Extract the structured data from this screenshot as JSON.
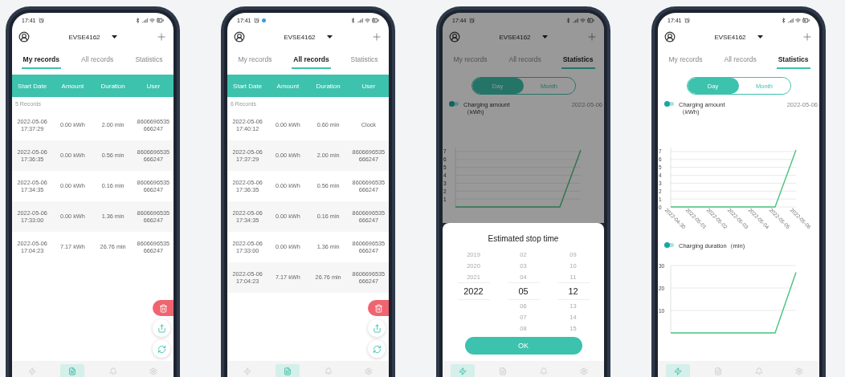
{
  "phones": [
    {
      "kind": "records",
      "status": {
        "time": "17:41"
      },
      "header": {
        "device": "EVSE4162"
      },
      "tabs": [
        {
          "label": "My records",
          "selected": true
        },
        {
          "label": "All records",
          "selected": false
        },
        {
          "label": "Statistics",
          "selected": false
        }
      ],
      "table": {
        "columns": [
          "Start Date",
          "Amount",
          "Duration",
          "User"
        ],
        "count": "5 Records",
        "rows": [
          {
            "date": "2022-05-06 17:37:29",
            "amount": "0.00 kWh",
            "duration": "2.00 min",
            "user": "8606696535 666247"
          },
          {
            "date": "2022-05-06 17:36:35",
            "amount": "0.00 kWh",
            "duration": "0.56 min",
            "user": "8606696535 666247"
          },
          {
            "date": "2022-05-06 17:34:35",
            "amount": "0.00 kWh",
            "duration": "0.16 min",
            "user": "8606696535 666247"
          },
          {
            "date": "2022-05-06 17:33:00",
            "amount": "0.00 kWh",
            "duration": "1.36 min",
            "user": "8606696535 666247"
          },
          {
            "date": "2022-05-06 17:04:23",
            "amount": "7.17 kWh",
            "duration": "26.76 min",
            "user": "8606696535 666247"
          }
        ]
      },
      "nav": [
        {
          "kind": "charge",
          "selected": false
        },
        {
          "kind": "records",
          "selected": true
        },
        {
          "kind": "alerts",
          "selected": false
        },
        {
          "kind": "settings",
          "selected": false
        }
      ]
    },
    {
      "kind": "records",
      "status": {
        "time": "17:41",
        "notification_dot": true
      },
      "header": {
        "device": "EVSE4162"
      },
      "tabs": [
        {
          "label": "My records",
          "selected": false
        },
        {
          "label": "All records",
          "selected": true
        },
        {
          "label": "Statistics",
          "selected": false
        }
      ],
      "table": {
        "columns": [
          "Start Date",
          "Amount",
          "Duration",
          "User"
        ],
        "count": "6 Records",
        "rows": [
          {
            "date": "2022-05-06 17:40:12",
            "amount": "0.00 kWh",
            "duration": "0.60 min",
            "user": "Clock"
          },
          {
            "date": "2022-05-06 17:37:29",
            "amount": "0.00 kWh",
            "duration": "2.00 min",
            "user": "8606696535 666247"
          },
          {
            "date": "2022-05-06 17:36:35",
            "amount": "0.00 kWh",
            "duration": "0.56 min",
            "user": "8606696535 666247"
          },
          {
            "date": "2022-05-06 17:34:35",
            "amount": "0.00 kWh",
            "duration": "0.16 min",
            "user": "8606696535 666247"
          },
          {
            "date": "2022-05-06 17:33:00",
            "amount": "0.00 kWh",
            "duration": "1.36 min",
            "user": "8606696535 666247"
          },
          {
            "date": "2022-05-06 17:04:23",
            "amount": "7.17 kWh",
            "duration": "26.76 min",
            "user": "8606696535 666247"
          }
        ]
      },
      "nav": [
        {
          "kind": "charge",
          "selected": false
        },
        {
          "kind": "records",
          "selected": true
        },
        {
          "kind": "alerts",
          "selected": false
        },
        {
          "kind": "settings",
          "selected": false
        }
      ]
    },
    {
      "kind": "statistics",
      "status": {
        "time": "17:44"
      },
      "header": {
        "device": "EVSE4162"
      },
      "tabs": [
        {
          "label": "My records",
          "selected": false
        },
        {
          "label": "All records",
          "selected": false
        },
        {
          "label": "Statistics",
          "selected": true
        }
      ],
      "stats": {
        "range": [
          {
            "label": "Day",
            "selected": true
          },
          {
            "label": "Month",
            "selected": false
          }
        ],
        "charts": [
          {
            "legend": "Charging amount（kWh)",
            "date": "2022-05-06",
            "chart_data": {
              "type": "line",
              "grid": true,
              "ylim": [
                0,
                7.5
              ],
              "yticks": [
                1,
                2,
                3,
                4,
                5,
                6,
                7
              ],
              "categories": [
                null,
                null,
                null,
                null,
                null,
                null,
                null
              ],
              "series": [
                {
                  "color": "#2c744c",
                  "values": [
                    0,
                    0,
                    0,
                    0,
                    0,
                    0,
                    7.2
                  ]
                }
              ]
            }
          }
        ]
      },
      "picker": {
        "title": "Estimated stop time",
        "columns": [
          {
            "items": [
              {
                "label": "2019",
                "selected": false
              },
              {
                "label": "2020",
                "selected": false
              },
              {
                "label": "2021",
                "selected": false
              },
              {
                "label": "2022",
                "selected": true
              }
            ]
          },
          {
            "items": [
              {
                "label": "02",
                "selected": false
              },
              {
                "label": "03",
                "selected": false
              },
              {
                "label": "04",
                "selected": false
              },
              {
                "label": "05",
                "selected": true
              },
              {
                "label": "06",
                "selected": false
              },
              {
                "label": "07",
                "selected": false
              },
              {
                "label": "08",
                "selected": false
              }
            ]
          },
          {
            "items": [
              {
                "label": "09",
                "selected": false
              },
              {
                "label": "10",
                "selected": false
              },
              {
                "label": "11",
                "selected": false
              },
              {
                "label": "12",
                "selected": true
              },
              {
                "label": "13",
                "selected": false
              },
              {
                "label": "14",
                "selected": false
              },
              {
                "label": "15",
                "selected": false
              }
            ]
          }
        ],
        "button": "OK"
      },
      "nav": [
        {
          "kind": "charge",
          "selected": true
        },
        {
          "kind": "records",
          "selected": false
        },
        {
          "kind": "alerts",
          "selected": false
        },
        {
          "kind": "settings",
          "selected": false
        }
      ]
    },
    {
      "kind": "statistics",
      "status": {
        "time": "17:41"
      },
      "header": {
        "device": "EVSE4162"
      },
      "tabs": [
        {
          "label": "My records",
          "selected": false
        },
        {
          "label": "All records",
          "selected": false
        },
        {
          "label": "Statistics",
          "selected": true
        }
      ],
      "stats": {
        "range": [
          {
            "label": "Day",
            "selected": true
          },
          {
            "label": "Month",
            "selected": false
          }
        ],
        "charts": [
          {
            "legend": "Charging amount（kWh)",
            "date": "2022-05-06",
            "chart_data": {
              "type": "line",
              "grid": true,
              "ylim": [
                0,
                7.5
              ],
              "yticks": [
                0,
                1,
                2,
                3,
                4,
                5,
                6,
                7
              ],
              "categories": [
                "2022-04-30",
                "2022-05-01",
                "2022-05-02",
                "2022-05-03",
                "2022-05-04",
                "2022-05-05",
                "2022-05-06"
              ],
              "series": [
                {
                  "color": "#49c27f",
                  "values": [
                    0,
                    0,
                    0,
                    0,
                    0,
                    0,
                    7.2
                  ]
                }
              ]
            }
          },
          {
            "legend": "Charging duration（min)",
            "chart_data": {
              "type": "line",
              "grid": true,
              "ylim": [
                0,
                30
              ],
              "yticks": [
                10,
                20,
                30
              ],
              "categories": [
                null,
                null,
                null,
                null,
                null,
                null,
                null
              ],
              "series": [
                {
                  "color": "#49c27f",
                  "values": [
                    0,
                    0,
                    0,
                    0,
                    0,
                    0,
                    27
                  ]
                }
              ]
            }
          }
        ]
      },
      "nav": [
        {
          "kind": "charge",
          "selected": true
        },
        {
          "kind": "records",
          "selected": false
        },
        {
          "kind": "alerts",
          "selected": false
        },
        {
          "kind": "settings",
          "selected": false
        }
      ]
    }
  ]
}
